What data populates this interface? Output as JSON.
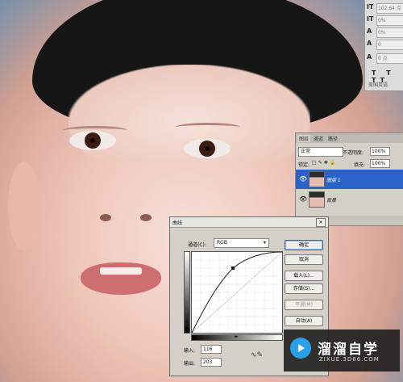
{
  "character": {
    "rows": [
      {
        "icon": "IT",
        "value": "102.64 点"
      },
      {
        "icon": "IT",
        "value": "0%"
      },
      {
        "icon": "A",
        "value": "0%"
      },
      {
        "icon": "A",
        "value": "0"
      },
      {
        "icon": "A",
        "value": "0 点"
      }
    ],
    "styles": "T T TT",
    "language": "美国英语"
  },
  "layers": {
    "tabs": [
      "图层",
      "通道",
      "路径"
    ],
    "blend_mode": "正常",
    "opacity_label": "不透明度:",
    "opacity_value": "100%",
    "lock_label": "锁定:",
    "fill_label": "填充:",
    "fill_value": "100%",
    "items": [
      {
        "name": "图层 1",
        "selected": true
      },
      {
        "name": "背景",
        "selected": false
      }
    ]
  },
  "curves": {
    "title": "曲线",
    "channel_label": "通道(C):",
    "channel_value": "RGB",
    "buttons": {
      "ok": "确定",
      "cancel": "取消",
      "load": "载入(L)...",
      "save": "存储(S)...",
      "smooth": "平滑(M)",
      "auto": "自动(A)"
    },
    "input_label": "输入:",
    "input_value": "116",
    "output_label": "输出:",
    "output_value": "203"
  },
  "watermark": {
    "brand": "溜溜自学",
    "domain": "ZIXUE.3D66.COM"
  }
}
